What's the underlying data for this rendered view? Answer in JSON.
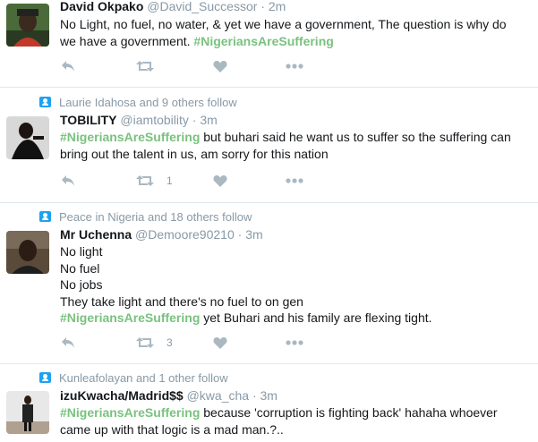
{
  "tweets": [
    {
      "name": "David Okpako",
      "handle": "@David_Successor",
      "dot": "·",
      "time": "2m",
      "text_before": "No Light, no fuel, no water, & yet we have a government, The question is why do\nwe have a government. ",
      "hashtag": "#NigeriansAreSuffering",
      "text_after": "",
      "retweets": ""
    },
    {
      "context": "Laurie Idahosa and 9 others follow",
      "name": "TOBILITY",
      "handle": "@iamtobility",
      "dot": "·",
      "time": "3m",
      "text_before": "",
      "hashtag": "#NigeriansAreSuffering",
      "text_after": " but buhari said he want us to suffer so the suffering can\nbring out the talent in us, am sorry for this nation",
      "retweets": "1"
    },
    {
      "context": "Peace in Nigeria and 18 others follow",
      "name": "Mr Uchenna",
      "handle": "@Demoore90210",
      "dot": "·",
      "time": "3m",
      "text_before": "No light\nNo fuel\nNo jobs\nThey take light and there's no fuel to on gen\n",
      "hashtag": "#NigeriansAreSuffering",
      "text_after": " yet Buhari and his family are flexing tight.",
      "retweets": "3"
    },
    {
      "context": "Kunleafolayan and 1 other follow",
      "name": "izuKwacha/Madrid$$",
      "handle": "@kwa_cha",
      "dot": "·",
      "time": "3m",
      "text_before": "",
      "hashtag": "#NigeriansAreSuffering",
      "text_after": " because 'corruption is fighting back' hahaha whoever\ncame up with that logic is a mad man.?..",
      "retweets": ""
    }
  ],
  "icons": {
    "reply": "reply-icon",
    "retweet": "retweet-icon",
    "like": "heart-icon",
    "more": "more-icon",
    "context": "person-icon"
  },
  "colors": {
    "hashtag": "#79c27e",
    "muted": "#8899a6",
    "context_icon": "#1da1f2",
    "divider": "#e1e8ed"
  }
}
